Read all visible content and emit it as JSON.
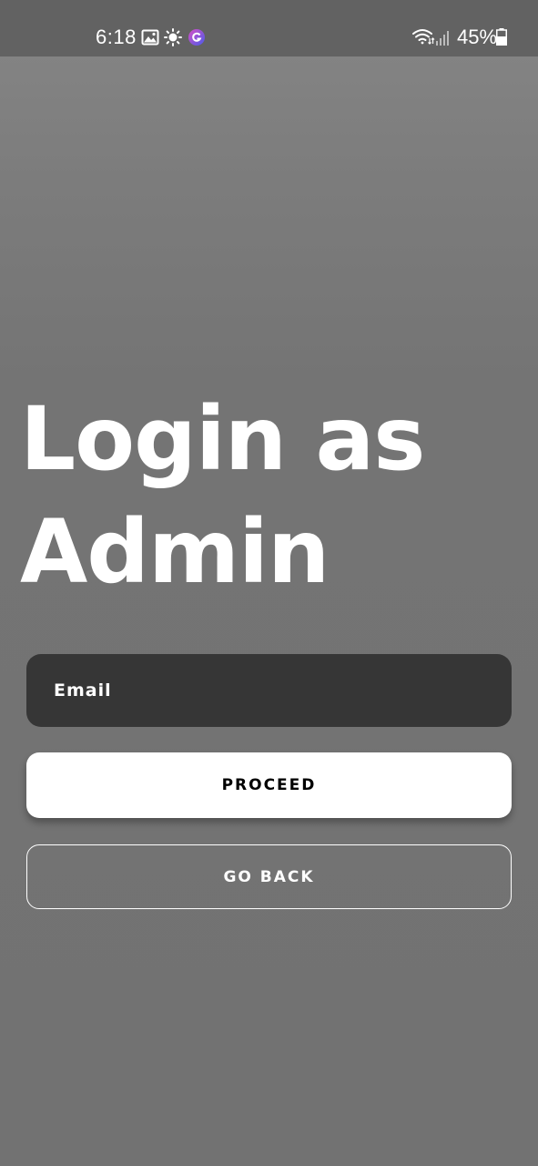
{
  "status_bar": {
    "time": "6:18",
    "battery_percent": "45%",
    "icons": [
      "gallery-icon",
      "sun-icon",
      "app-notification-icon",
      "wifi-icon",
      "signal-icon",
      "battery-icon"
    ]
  },
  "title": {
    "line1": "Login as",
    "line2": "Admin"
  },
  "form": {
    "email_placeholder": "Email",
    "email_value": ""
  },
  "actions": {
    "proceed_label": "PROCEED",
    "go_back_label": "GO BACK"
  },
  "colors": {
    "background": "#747474",
    "status_bar": "#626262",
    "input_background": "#363636",
    "button_primary": "#ffffff",
    "text_light": "#ffffff",
    "text_dark": "#000000"
  }
}
